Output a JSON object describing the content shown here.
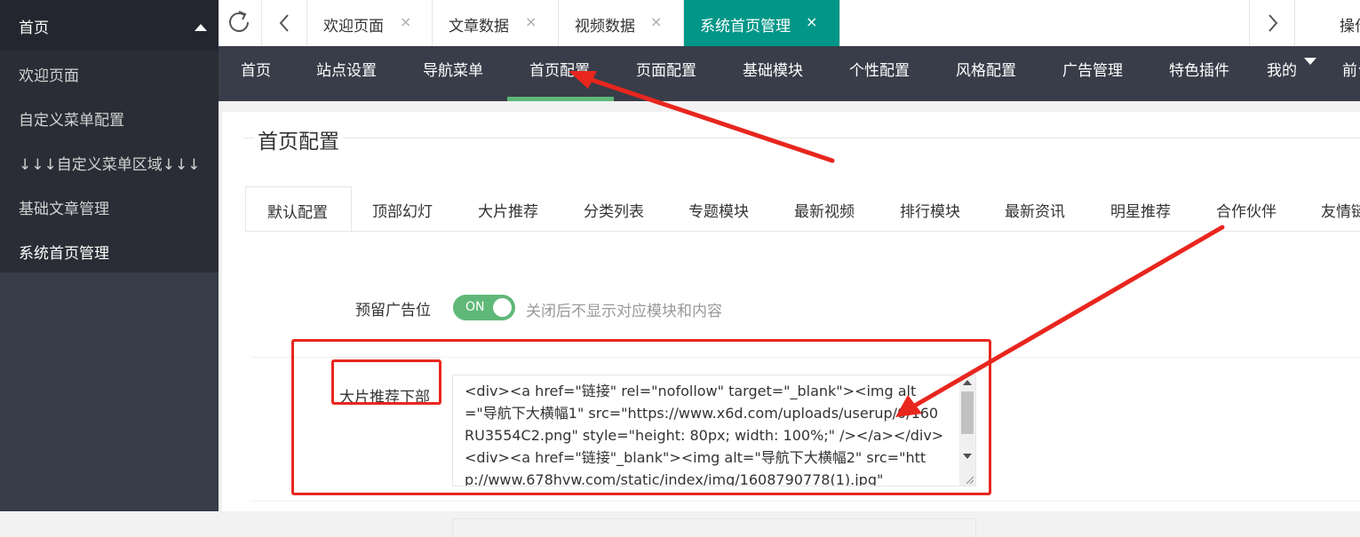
{
  "sidebar": {
    "header": "首页",
    "items": [
      {
        "label": "欢迎页面"
      },
      {
        "label": "自定义菜单配置"
      },
      {
        "label": "↓↓↓自定义菜单区域↓↓↓"
      },
      {
        "label": "基础文章管理"
      },
      {
        "label": "系统首页管理"
      }
    ]
  },
  "page_tabs": [
    {
      "label": "欢迎页面",
      "close": "×"
    },
    {
      "label": "文章数据",
      "close": "×"
    },
    {
      "label": "视频数据",
      "close": "×"
    },
    {
      "label": "系统首页管理",
      "close": "×"
    }
  ],
  "tabbar": {
    "ops_label": "操作"
  },
  "top_nav": [
    "首页",
    "站点设置",
    "导航菜单",
    "首页配置",
    "页面配置",
    "基础模块",
    "个性配置",
    "风格配置",
    "广告管理",
    "特色插件",
    "我的",
    "前台"
  ],
  "section": {
    "title": "首页配置"
  },
  "content_tabs": [
    "默认配置",
    "顶部幻灯",
    "大片推荐",
    "分类列表",
    "专题模块",
    "最新视频",
    "排行模块",
    "最新资讯",
    "明星推荐",
    "合作伙伴",
    "友情链接"
  ],
  "form": {
    "ad_slot": {
      "label": "预留广告位",
      "switch_text": "ON",
      "switch_on": true,
      "aux": "关闭后不显示对应模块和内容"
    },
    "banner_bottom": {
      "label": "大片推荐下部",
      "value": "<div><a href=\"链接\" rel=\"nofollow\" target=\"_blank\"><img alt=\"导航下大横幅1\" src=\"https://www.x6d.com/uploads/userup/0/160RU3554C2.png\" style=\"height: 80px; width: 100%;\" /></a></div>\n<div><a href=\"链接\"_blank\"><img alt=\"导航下大横幅2\" src=\"http://www.678hvw.com/static/index/img/1608790778(1).jpg\""
    }
  },
  "colors": {
    "sidebar_bg": "#393d49",
    "accent": "#009688",
    "switch_green": "#5fb878",
    "annotation_red": "#e8261e"
  }
}
